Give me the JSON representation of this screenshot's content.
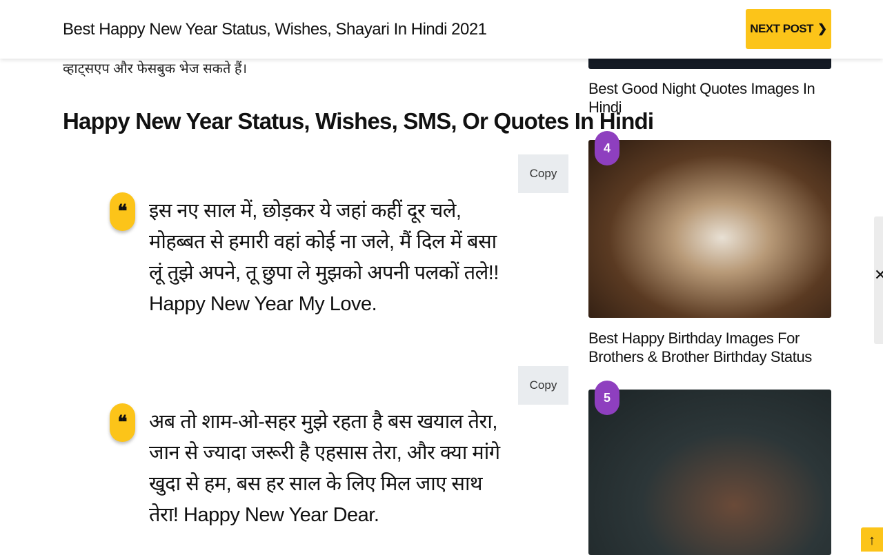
{
  "header": {
    "title": "Best Happy New Year Status, Wishes, Shayari In Hindi 2021",
    "next_label": "NEXT POST",
    "next_icon": "chevron-right-icon"
  },
  "article": {
    "intro_tail": "व्हाट्सएप और फेसबुक भेज सकते हैं।",
    "heading": "Happy New Year Status, Wishes, SMS, Or Quotes In Hindi",
    "quotes": [
      {
        "copy_label": "Copy",
        "text": "इस नए साल में, छोड़कर ये जहां कहीं दूर चले, मोहब्बत से हमारी वहां कोई ना जले, मैं दिल में बसा लूं तुझे अपने, तू छुपा ले मुझको अपनी पलकों तले!! Happy New Year My Love."
      },
      {
        "copy_label": "Copy",
        "text": "अब तो शाम-ओ-सहर मुझे रहता है बस खयाल तेरा, जान से ज्यादा जरूरी है एहसास तेरा, और क्या मांगे खुदा से हम, बस हर साल के लिए मिल जाए साथ तेरा! Happy New Year Dear."
      }
    ]
  },
  "sidebar": {
    "posts": [
      {
        "title": "Best Good Night Quotes Images In Hindi"
      },
      {
        "rank": "4",
        "title": "Best Happy Birthday Images For Brothers & Brother Birthday Status"
      },
      {
        "rank": "5"
      }
    ]
  },
  "colors": {
    "accent": "#fcc419",
    "badge": "#8e3fbf",
    "copy_bg": "#e9ecef"
  }
}
